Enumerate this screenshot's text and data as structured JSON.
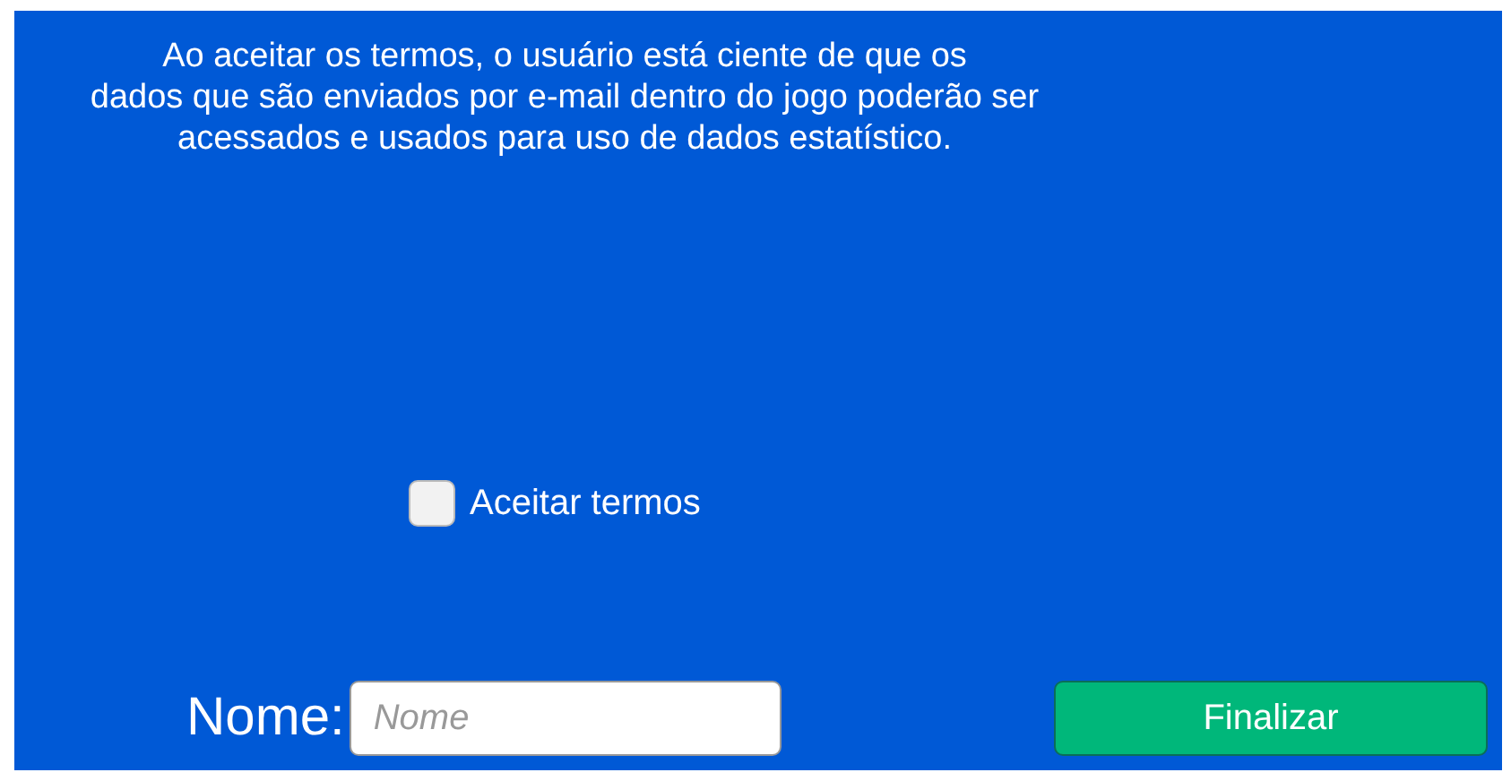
{
  "message_lines": [
    "Ao aceitar os termos, o usuário está ciente de que os",
    "dados que são enviados por e-mail dentro do jogo poderão ser",
    "acessados e usados para uso de dados estatístico."
  ],
  "accept_terms": {
    "label": "Aceitar termos",
    "checked": false
  },
  "name_field": {
    "label": "Nome:",
    "placeholder": "Nome"
  },
  "submit_button": {
    "label": "Finalizar"
  }
}
